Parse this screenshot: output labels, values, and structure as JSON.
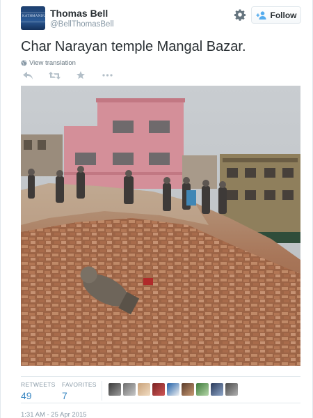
{
  "author": {
    "name": "Thomas Bell",
    "handle": "@BellThomasBell",
    "avatar_label": "KATHMANDU"
  },
  "header_actions": {
    "settings_icon": "gear-icon",
    "follow_icon": "add-person-icon",
    "follow_label": "Follow"
  },
  "tweet": {
    "text": "Char Narayan temple Mangal Bazar.",
    "translate_label": "View translation",
    "translate_icon": "globe-icon"
  },
  "actions": [
    {
      "name": "reply",
      "icon": "reply-icon"
    },
    {
      "name": "retweet",
      "icon": "retweet-icon"
    },
    {
      "name": "favorite",
      "icon": "star-icon"
    },
    {
      "name": "more",
      "icon": "more-icon"
    }
  ],
  "media": {
    "type": "photo"
  },
  "stats": {
    "retweets_label": "RETWEETS",
    "retweets_count": "49",
    "favorites_label": "FAVORITES",
    "favorites_count": "7",
    "favoriter_avatar_count": 9
  },
  "timestamp": "1:31 AM - 25 Apr 2015",
  "colors": {
    "text": "#292f33",
    "muted": "#8899a6",
    "link_blue": "#3b88c3",
    "follow_icon_blue": "#55acee",
    "border": "#e1e8ed"
  }
}
